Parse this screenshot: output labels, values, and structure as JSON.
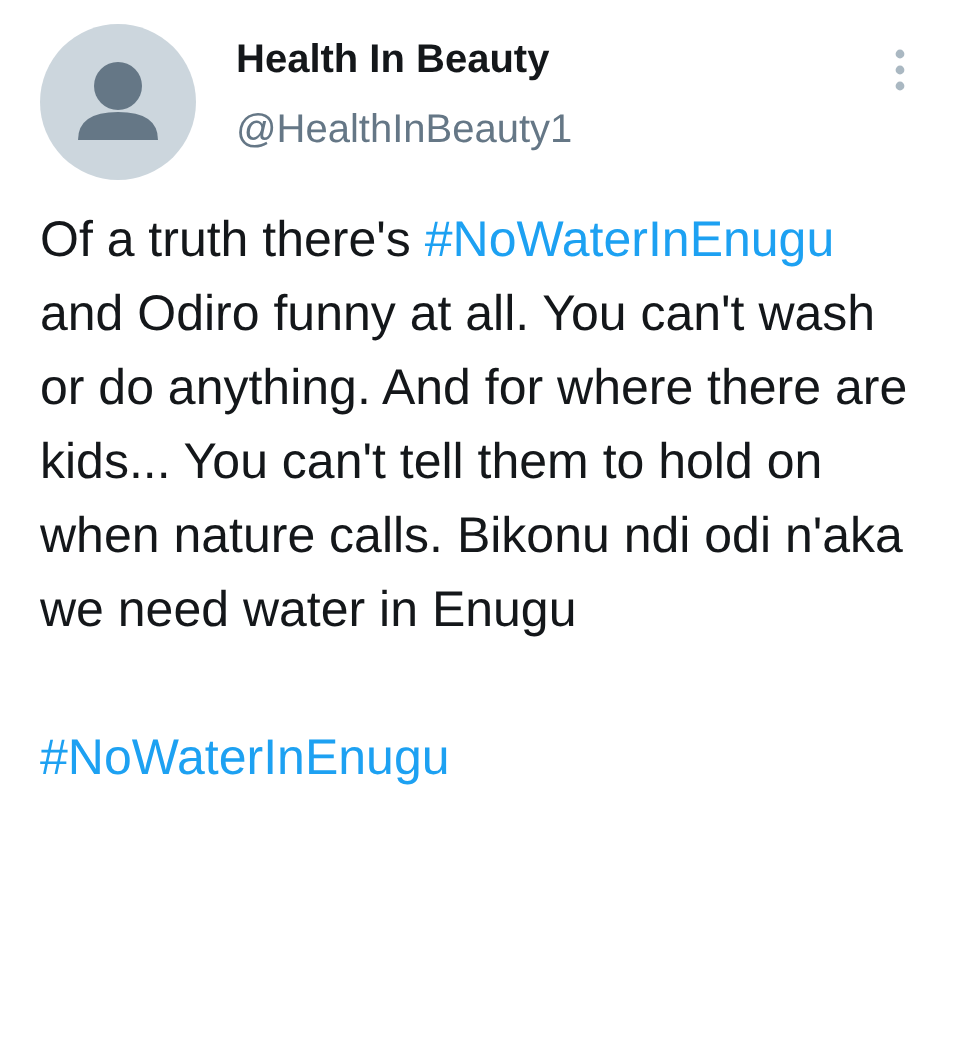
{
  "author": {
    "name": "Health In Beauty",
    "handle": "@HealthInBeauty1"
  },
  "tweet": {
    "paragraphs": [
      {
        "segments": [
          {
            "kind": "text",
            "text": "Of a truth there's "
          },
          {
            "kind": "hashtag",
            "text": "#NoWaterInEnugu"
          },
          {
            "kind": "text",
            "text": " and Odiro funny at all. You can't wash or do anything. And for where there are kids... You can't tell them to hold on when nature calls. Bikonu ndi odi n'aka we need water in Enugu"
          }
        ]
      },
      {
        "segments": [
          {
            "kind": "hashtag",
            "text": "#NoWaterInEnugu"
          }
        ]
      }
    ]
  }
}
